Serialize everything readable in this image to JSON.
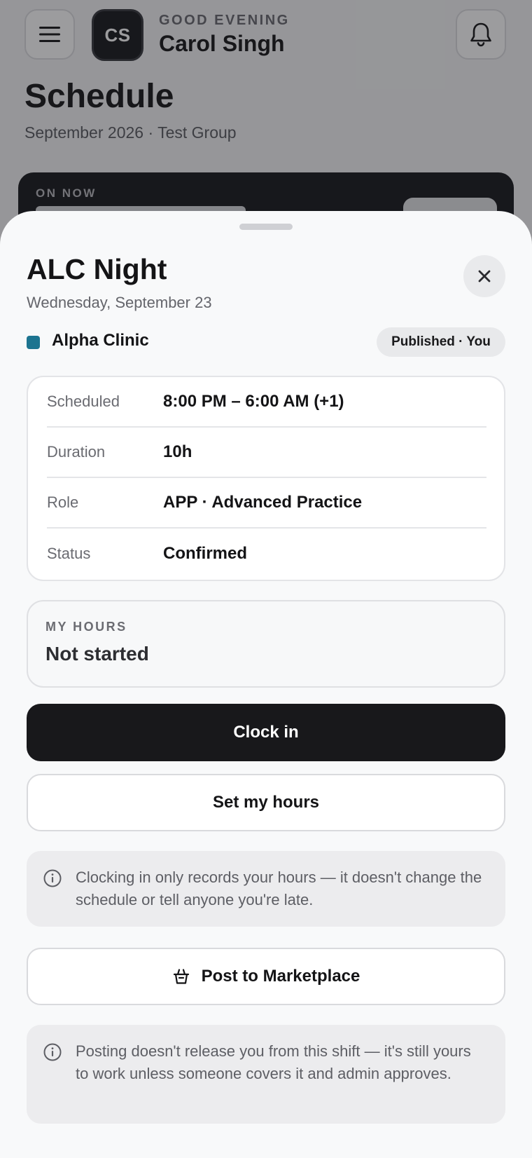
{
  "header": {
    "avatar_initials": "CS",
    "greeting": "GOOD EVENING",
    "user_name": "Carol Singh",
    "menu_icon": "hamburger-menu-icon",
    "bell_icon": "bell-icon"
  },
  "page": {
    "title": "Schedule",
    "subtitle": "September 2026 · Test Group",
    "on_now_label": "ON NOW"
  },
  "sheet": {
    "title": "ALC Night",
    "date": "Wednesday, September 23",
    "close_icon": "close-icon",
    "clinic": {
      "name": "Alpha Clinic",
      "color": "#1c7490"
    },
    "status_pill": "Published · You",
    "details": [
      {
        "label": "Scheduled",
        "value": "8:00 PM – 6:00 AM (+1)"
      },
      {
        "label": "Duration",
        "value": "10h"
      },
      {
        "label": "Role",
        "value": "APP · Advanced Practice"
      },
      {
        "label": "Status",
        "value": "Confirmed"
      }
    ],
    "my_hours": {
      "label": "MY HOURS",
      "value": "Not started"
    },
    "clock_in_label": "Clock in",
    "set_hours_label": "Set my hours",
    "clock_note": "Clocking in only records your hours — it doesn't change the schedule or tell anyone you're late.",
    "marketplace_label": "Post to Marketplace",
    "marketplace_icon": "basket-icon",
    "marketplace_note": "Posting doesn't release you from this shift — it's still yours to work unless someone covers it and admin approves."
  },
  "colors": {
    "primary_button": "#18181b",
    "clinic_accent": "#1c7490"
  }
}
